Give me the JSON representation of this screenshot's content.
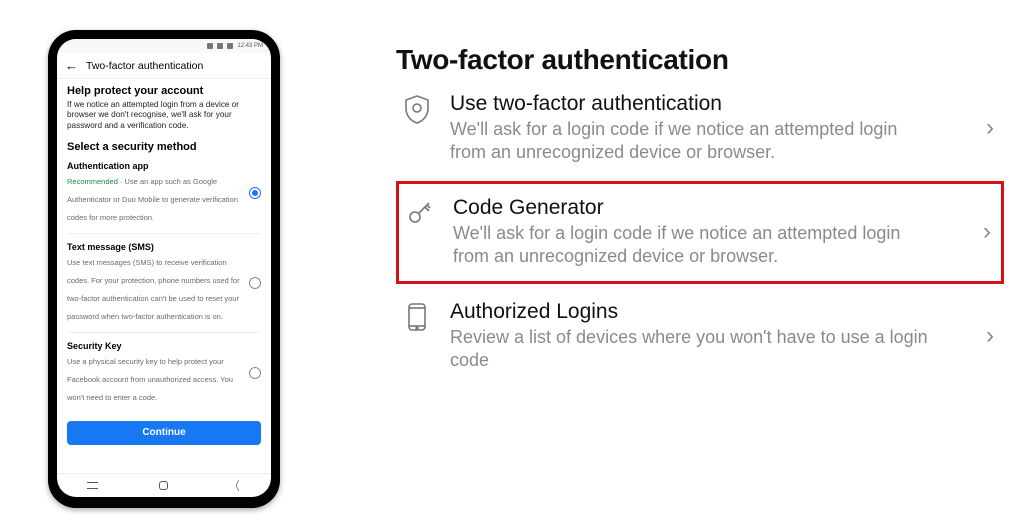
{
  "phone": {
    "status_time": "12:43 PM",
    "page_title": "Two-factor authentication",
    "help_title": "Help protect your account",
    "help_desc": "If we notice an attempted login from a device or browser we don't recognise, we'll ask for your password and a verification code.",
    "select_title": "Select a security method",
    "methods": [
      {
        "title": "Authentication app",
        "recommended": "Recommended · ",
        "desc": "Use an app such as Google Authenticator or Duo Mobile to generate verification codes for more protection.",
        "selected": true
      },
      {
        "title": "Text message (SMS)",
        "recommended": "",
        "desc": "Use text messages (SMS) to receive verification codes. For your protection, phone numbers used for two-factor authentication can't be used to reset your password when two-factor authentication is on.",
        "selected": false
      },
      {
        "title": "Security Key",
        "recommended": "",
        "desc": "Use a physical security key to help protect your Facebook account from unauthorized access. You won't need to enter a code.",
        "selected": false
      }
    ],
    "continue_label": "Continue"
  },
  "panel": {
    "heading": "Two-factor authentication",
    "rows": [
      {
        "id": "use-2fa",
        "icon": "shield-icon",
        "title": "Use two-factor authentication",
        "desc": "We'll ask for a login code if we notice an attempted login from an unrecognized device or browser.",
        "highlighted": false
      },
      {
        "id": "code-generator",
        "icon": "key-icon",
        "title": "Code Generator",
        "desc": "We'll ask for a login code if we notice an attempted login from an unrecognized device or browser.",
        "highlighted": true
      },
      {
        "id": "authorized-logins",
        "icon": "phone-icon",
        "title": "Authorized Logins",
        "desc": "Review a list of devices where you won't have to use a login code",
        "highlighted": false
      }
    ]
  }
}
